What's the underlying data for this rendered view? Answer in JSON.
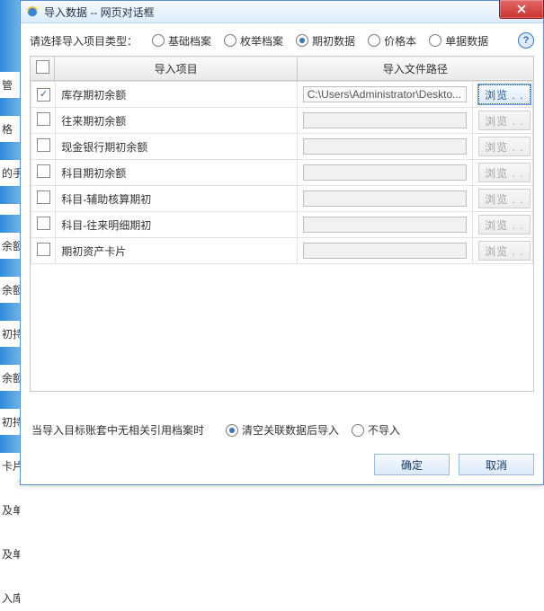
{
  "sidebar": {
    "items": [
      "管",
      "格",
      "的手",
      "",
      "余额",
      "余额",
      "初持",
      "余额",
      "初持",
      "卡片",
      "及单",
      "及单",
      "入库"
    ]
  },
  "dialog": {
    "title": "导入数据 -- 网页对话框",
    "close": "X",
    "type_label": "请选择导入项目类型：",
    "radios": [
      {
        "label": "基础档案",
        "checked": false
      },
      {
        "label": "枚举档案",
        "checked": false
      },
      {
        "label": "期初数据",
        "checked": true
      },
      {
        "label": "价格本",
        "checked": false
      },
      {
        "label": "单据数据",
        "checked": false
      }
    ],
    "help": "?",
    "headers": {
      "item": "导入项目",
      "path": "导入文件路径"
    },
    "rows": [
      {
        "checked": true,
        "label": "库存期初余额",
        "path": "C:\\Users\\Administrator\\Deskto...",
        "browse": "浏览 . .",
        "enabled": true
      },
      {
        "checked": false,
        "label": "往来期初余额",
        "path": "",
        "browse": "浏览 . .",
        "enabled": false
      },
      {
        "checked": false,
        "label": "现金银行期初余额",
        "path": "",
        "browse": "浏览 . .",
        "enabled": false
      },
      {
        "checked": false,
        "label": "科目期初余额",
        "path": "",
        "browse": "浏览 . .",
        "enabled": false
      },
      {
        "checked": false,
        "label": "科目-辅助核算期初",
        "path": "",
        "browse": "浏览 . .",
        "enabled": false
      },
      {
        "checked": false,
        "label": "科目-往来明细期初",
        "path": "",
        "browse": "浏览 . .",
        "enabled": false
      },
      {
        "checked": false,
        "label": "期初资产卡片",
        "path": "",
        "browse": "浏览 . .",
        "enabled": false
      }
    ],
    "footer_label": "当导入目标账套中无相关引用档案时",
    "footer_radios": [
      {
        "label": "清空关联数据后导入",
        "checked": true
      },
      {
        "label": "不导入",
        "checked": false
      }
    ],
    "ok": "确定",
    "cancel": "取消"
  }
}
